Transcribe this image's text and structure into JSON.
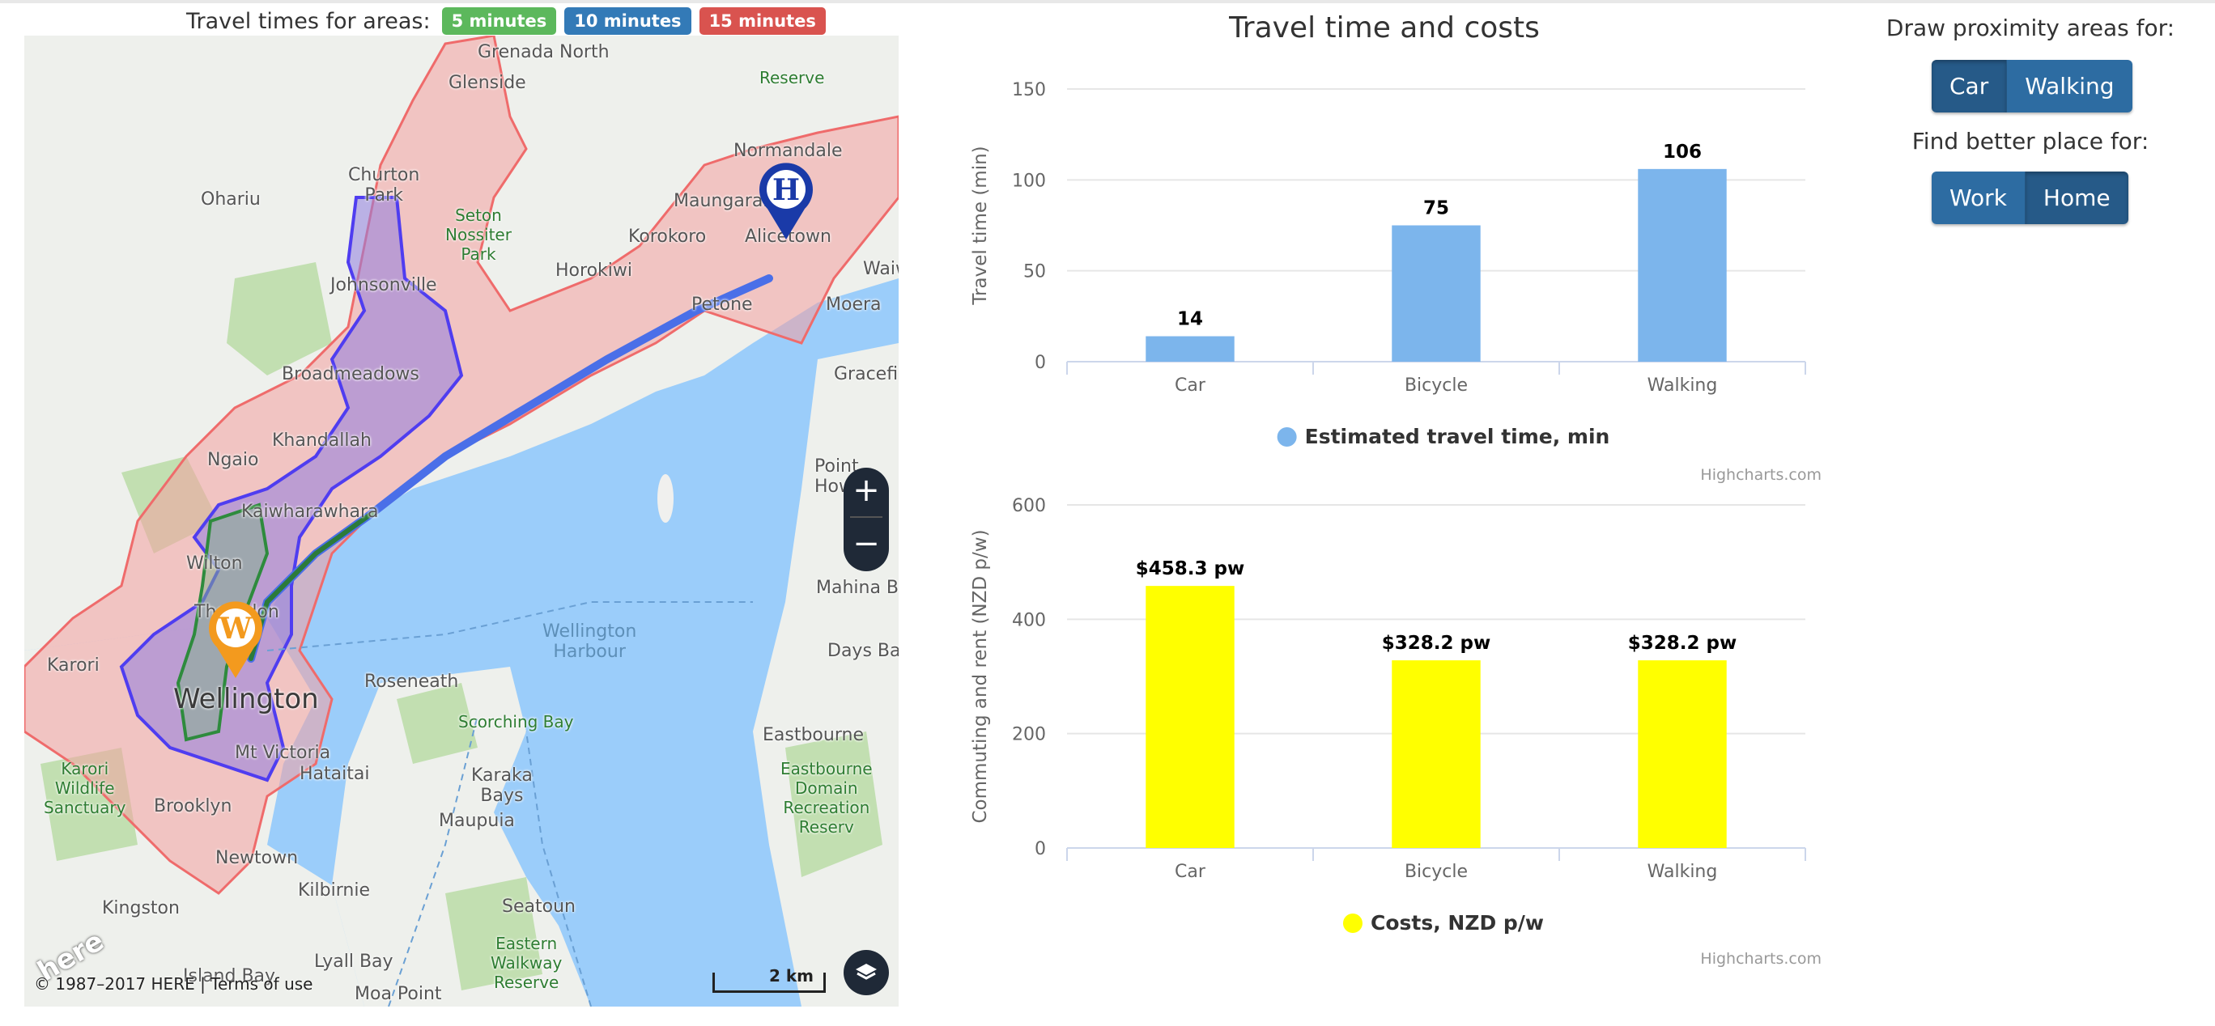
{
  "areas_legend": {
    "title": "Travel times for areas:",
    "badges": [
      "5 minutes",
      "10 minutes",
      "15 minutes"
    ]
  },
  "map": {
    "labels": {
      "grenada_north": "Grenada North",
      "glenside": "Glenside",
      "ohariu": "Ohariu",
      "churton_park": "Churton\nPark",
      "seton_nossiter": "Seton\nNossiter\nPark",
      "johnsonville": "Johnsonville",
      "broadmeadows": "Broadmeadows",
      "ngaio": "Ngaio",
      "khandallah": "Khandallah",
      "kaiwharawhara": "Kaiwharawhara",
      "wilton": "Wilton",
      "thorndon": "Thorndon",
      "karori": "Karori",
      "wellington": "Wellington",
      "karori_wildlife": "Karori\nWildlife\nSanctuary",
      "mt_victoria": "Mt Victoria",
      "brooklyn": "Brooklyn",
      "hataitai": "Hataitai",
      "newtown": "Newtown",
      "kingston": "Kingston",
      "kilbirnie": "Kilbirnie",
      "island_bay": "Island Bay",
      "lyall_bay": "Lyall Bay",
      "moa_point": "Moa Point",
      "seatoun": "Seatoun",
      "maupuia": "Maupuia",
      "karaka_bays": "Karaka\nBays",
      "roseneath": "Roseneath",
      "scorching_bay": "Scorching Bay",
      "eastern_walkway": "Eastern\nWalkway\nReserve",
      "wellington_harbour": "Wellington\nHarbour",
      "days_bay": "Days Bay",
      "eastbourne": "Eastbourne",
      "eastbourne_domain": "Eastbourne\nDomain\nRecreation\nReserv",
      "mahina_bay": "Mahina Bay",
      "point_howard": "Point\nHow",
      "petone": "Petone",
      "moera": "Moera",
      "gracefield": "Gracefi",
      "alicetown": "Alicetown",
      "maungaraki": "Maungaraki",
      "korokoro": "Korokoro",
      "horokiwi": "Horokiwi",
      "normandale": "Normandale",
      "waiwhetu": "Waiw",
      "reserve": "Reserve"
    },
    "home_pin": "H",
    "work_pin": "W",
    "copyright": "© 1987–2017 HERE | Terms of use",
    "scale": "2 km",
    "logo": "here",
    "zoom_in": "+",
    "zoom_out": "−"
  },
  "chart_title": "Travel time and costs",
  "chart_data": [
    {
      "type": "bar",
      "categories": [
        "Car",
        "Bicycle",
        "Walking"
      ],
      "values": [
        14,
        75,
        106
      ],
      "data_labels": [
        "14",
        "75",
        "106"
      ],
      "ylabel": "Travel time (min)",
      "ylim": [
        0,
        150
      ],
      "yticks": [
        "0",
        "50",
        "100",
        "150"
      ],
      "series_name": "Estimated travel time, min",
      "color": "#7cb5ec",
      "credit": "Highcharts.com"
    },
    {
      "type": "bar",
      "categories": [
        "Car",
        "Bicycle",
        "Walking"
      ],
      "values": [
        458.3,
        328.2,
        328.2
      ],
      "data_labels": [
        "$458.3 pw",
        "$328.2 pw",
        "$328.2 pw"
      ],
      "ylabel": "Commuting and rent (NZD p/w)",
      "ylim": [
        0,
        600
      ],
      "yticks": [
        "0",
        "200",
        "400",
        "600"
      ],
      "series_name": "Costs, NZD p/w",
      "color": "#ffff00",
      "credit": "Highcharts.com"
    }
  ],
  "controls": {
    "draw_label": "Draw proximity areas for:",
    "draw_buttons": [
      "Car",
      "Walking"
    ],
    "better_label": "Find better place for:",
    "better_buttons": [
      "Work",
      "Home"
    ]
  }
}
